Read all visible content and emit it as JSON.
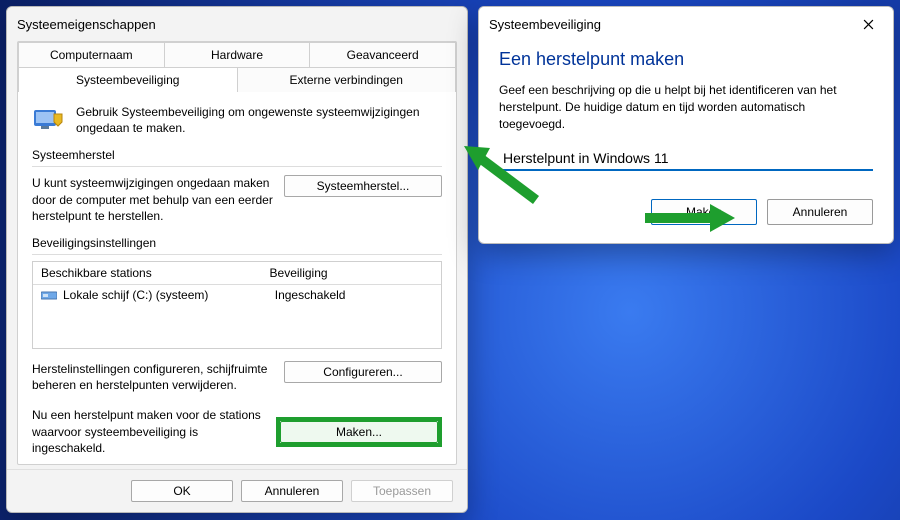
{
  "sysprops": {
    "title": "Systeemeigenschappen",
    "tabs": {
      "computername": "Computernaam",
      "hardware": "Hardware",
      "advanced": "Geavanceerd",
      "protection": "Systeembeveiliging",
      "remote": "Externe verbindingen"
    },
    "intro": "Gebruik Systeembeveiliging om ongewenste systeemwijzigingen ongedaan te maken.",
    "restore": {
      "heading": "Systeemherstel",
      "text": "U kunt systeemwijzigingen ongedaan maken door de computer met behulp van een eerder herstelpunt te herstellen.",
      "button": "Systeemherstel..."
    },
    "settings": {
      "heading": "Beveiligingsinstellingen",
      "col_drive": "Beschikbare stations",
      "col_prot": "Beveiliging",
      "row_drive": "Lokale schijf (C:) (systeem)",
      "row_prot": "Ingeschakeld",
      "config_text": "Herstelinstellingen configureren, schijfruimte beheren en herstelpunten verwijderen.",
      "config_button": "Configureren...",
      "create_text": "Nu een herstelpunt maken voor de stations waarvoor systeembeveiliging is ingeschakeld.",
      "create_button": "Maken..."
    },
    "buttons": {
      "ok": "OK",
      "cancel": "Annuleren",
      "apply": "Toepassen"
    }
  },
  "createrp": {
    "title": "Systeembeveiliging",
    "heading": "Een herstelpunt maken",
    "desc": "Geef een beschrijving op die u helpt bij het identificeren van het herstelpunt. De huidige datum en tijd worden automatisch toegevoegd.",
    "input_value": "Herstelpunt in Windows 11",
    "create": "Maken",
    "cancel": "Annuleren"
  }
}
